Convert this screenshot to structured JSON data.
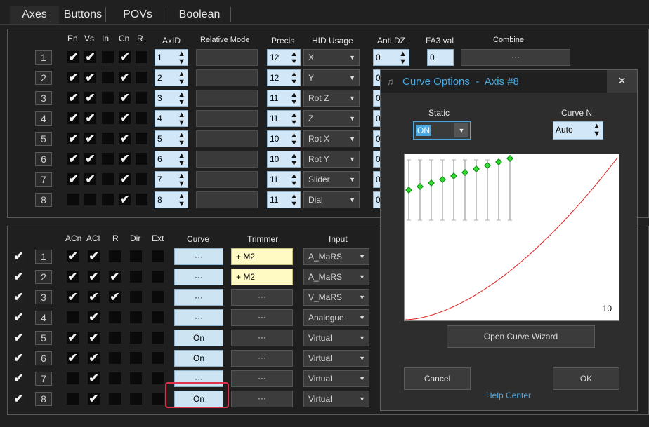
{
  "tabs": [
    "Axes",
    "Buttons",
    "POVs",
    "Boolean"
  ],
  "axes_table": {
    "headers": {
      "en": "En",
      "vs": "Vs",
      "in": "In",
      "cn": "Cn",
      "r": "R",
      "axid": "AxID",
      "relative": "Relative Mode",
      "precis": "Precis",
      "hid": "HID Usage",
      "antidz": "Anti DZ",
      "fa3": "FA3 val",
      "combine": "Combine"
    },
    "rows": [
      {
        "num": "1",
        "axid": "1",
        "precis": "12",
        "hid": "X",
        "antidz": "0",
        "fa3": "0",
        "combine": "···"
      },
      {
        "num": "2",
        "axid": "2",
        "precis": "12",
        "hid": "Y",
        "antidz": "0"
      },
      {
        "num": "3",
        "axid": "3",
        "precis": "11",
        "hid": "Rot Z",
        "antidz": "0"
      },
      {
        "num": "4",
        "axid": "4",
        "precis": "11",
        "hid": "Z",
        "antidz": "0"
      },
      {
        "num": "5",
        "axid": "5",
        "precis": "10",
        "hid": "Rot X",
        "antidz": "0"
      },
      {
        "num": "6",
        "axid": "6",
        "precis": "10",
        "hid": "Rot Y",
        "antidz": "0"
      },
      {
        "num": "7",
        "axid": "7",
        "precis": "11",
        "hid": "Slider",
        "antidz": "0"
      },
      {
        "num": "8",
        "axid": "8",
        "precis": "11",
        "hid": "Dial",
        "antidz": "0"
      }
    ],
    "checks": [
      [
        1,
        1,
        0,
        1,
        0
      ],
      [
        1,
        1,
        0,
        1,
        0
      ],
      [
        1,
        1,
        0,
        1,
        0
      ],
      [
        1,
        1,
        0,
        1,
        0
      ],
      [
        1,
        1,
        0,
        1,
        0
      ],
      [
        1,
        1,
        0,
        1,
        0
      ],
      [
        1,
        1,
        0,
        1,
        0
      ],
      [
        0,
        0,
        0,
        1,
        0
      ]
    ]
  },
  "mapping_table": {
    "headers": {
      "acn": "ACn",
      "acl": "ACl",
      "r": "R",
      "dir": "Dir",
      "ext": "Ext",
      "curve": "Curve",
      "trimmer": "Trimmer",
      "input": "Input"
    },
    "rows": [
      {
        "num": "1",
        "curve": "···",
        "trimmer": "+ M2",
        "input": "A_MaRS"
      },
      {
        "num": "2",
        "curve": "···",
        "trimmer": "+ M2",
        "input": "A_MaRS"
      },
      {
        "num": "3",
        "curve": "···",
        "trimmer": "···",
        "input": "V_MaRS"
      },
      {
        "num": "4",
        "curve": "···",
        "trimmer": "···",
        "input": "Analogue"
      },
      {
        "num": "5",
        "curve": "On",
        "trimmer": "···",
        "input": "Virtual"
      },
      {
        "num": "6",
        "curve": "On",
        "trimmer": "···",
        "input": "Virtual"
      },
      {
        "num": "7",
        "curve": "···",
        "trimmer": "···",
        "input": "Virtual"
      },
      {
        "num": "8",
        "curve": "On",
        "trimmer": "···",
        "input": "Virtual"
      }
    ],
    "enabled": [
      1,
      1,
      1,
      1,
      1,
      1,
      1,
      1
    ],
    "checks": [
      [
        1,
        1,
        0,
        0,
        0
      ],
      [
        1,
        1,
        1,
        0,
        0
      ],
      [
        1,
        1,
        1,
        0,
        0
      ],
      [
        0,
        1,
        0,
        0,
        0
      ],
      [
        1,
        1,
        0,
        0,
        0
      ],
      [
        1,
        1,
        0,
        0,
        0
      ],
      [
        0,
        1,
        0,
        0,
        0
      ],
      [
        0,
        1,
        0,
        0,
        0
      ]
    ]
  },
  "dialog": {
    "title": "Curve Options  -  Axis #8",
    "close": "×",
    "static_label": "Static",
    "static_value": "ON",
    "curven_label": "Curve N",
    "curven_value": "Auto",
    "curve_n_display": "10",
    "open_wizard": "Open Curve Wizard",
    "cancel": "Cancel",
    "ok": "OK",
    "help": "Help Center"
  },
  "colors": {
    "accent": "#4aa8e0",
    "highlight": "#e0324a",
    "curve": "#e02020",
    "points": "#33dd33"
  }
}
